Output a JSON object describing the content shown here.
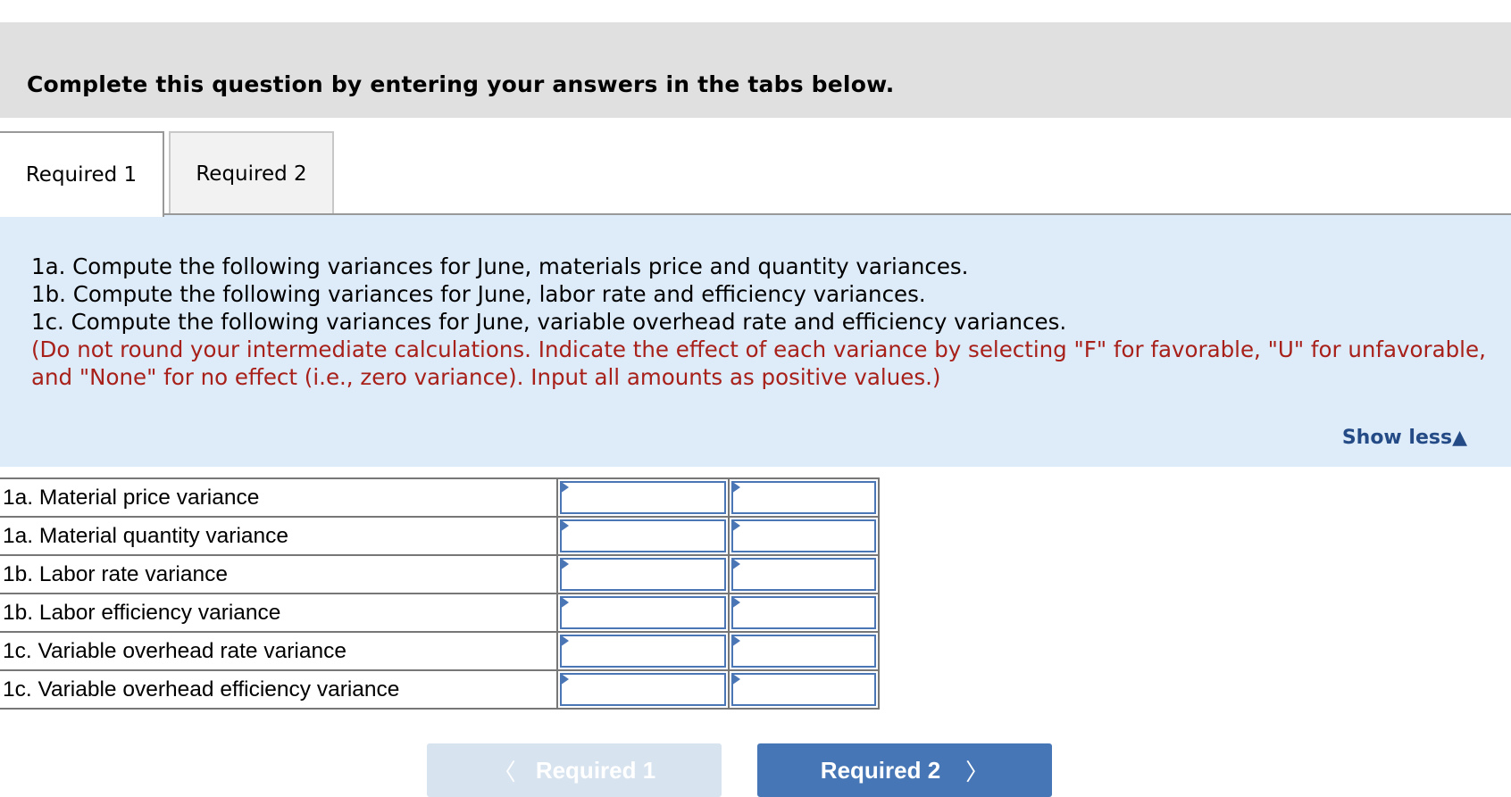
{
  "header": {
    "title": "Complete this question by entering your answers in the tabs below."
  },
  "tabs": [
    {
      "label": "Required 1",
      "active": true
    },
    {
      "label": "Required 2",
      "active": false
    }
  ],
  "instructions": {
    "lines": [
      "1a. Compute the following variances for June, materials price and quantity variances.",
      "1b. Compute the following variances for June, labor rate and efficiency variances.",
      "1c. Compute the following variances for June, variable overhead rate and efficiency variances."
    ],
    "note": "(Do not round your intermediate calculations. Indicate the effect of each variance by selecting \"F\" for favorable, \"U\" for unfavorable, and \"None\" for no effect (i.e., zero variance). Input all amounts as positive values.)",
    "note_color": "#a8201a",
    "show_less_label": "Show less",
    "show_less_icon": "triangle-up-icon"
  },
  "table": {
    "rows": [
      {
        "label": "1a. Material price variance",
        "amount": "",
        "effect": ""
      },
      {
        "label": "1a. Material quantity variance",
        "amount": "",
        "effect": ""
      },
      {
        "label": "1b. Labor rate variance",
        "amount": "",
        "effect": ""
      },
      {
        "label": "1b. Labor efficiency variance",
        "amount": "",
        "effect": ""
      },
      {
        "label": "1c. Variable overhead rate variance",
        "amount": "",
        "effect": ""
      },
      {
        "label": "1c. Variable overhead efficiency variance",
        "amount": "",
        "effect": ""
      }
    ]
  },
  "nav": {
    "prev_label": "Required 1",
    "prev_icon": "chevron-left-icon",
    "prev_disabled": true,
    "next_label": "Required 2",
    "next_icon": "chevron-right-icon"
  },
  "colors": {
    "accent": "#4676b5",
    "panel": "#deebf8",
    "header": "#e0e0e0",
    "link": "#244b86"
  }
}
